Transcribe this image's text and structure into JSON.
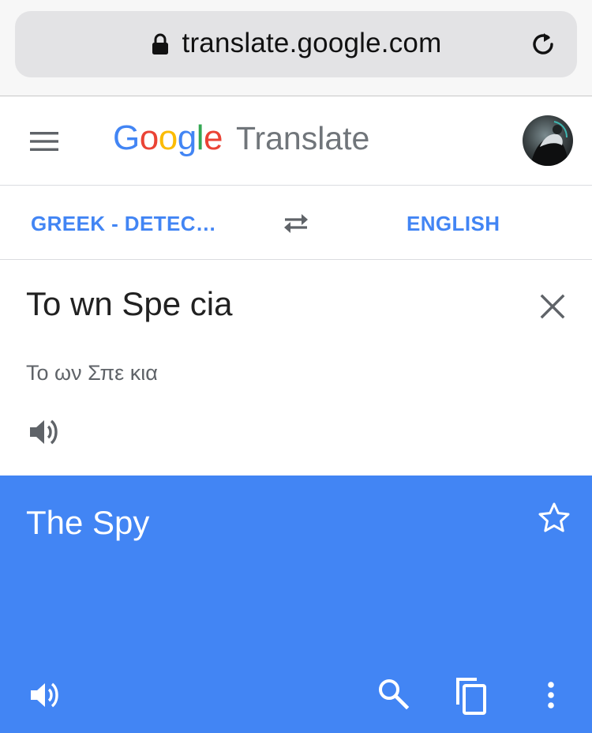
{
  "browser": {
    "url": "translate.google.com",
    "icons": {
      "lock": "lock-icon",
      "reload": "reload-icon"
    }
  },
  "header": {
    "brand_letters": [
      {
        "char": "G",
        "color": "#4285f4"
      },
      {
        "char": "o",
        "color": "#ea4335"
      },
      {
        "char": "o",
        "color": "#fbbc05"
      },
      {
        "char": "g",
        "color": "#4285f4"
      },
      {
        "char": "l",
        "color": "#34a853"
      },
      {
        "char": "e",
        "color": "#ea4335"
      }
    ],
    "product_name": "Translate",
    "icons": {
      "menu": "hamburger-menu-icon",
      "avatar": "account-avatar"
    }
  },
  "language_bar": {
    "source_language": "GREEK - DETEC…",
    "target_language": "ENGLISH",
    "swap_icon": "swap-languages-icon"
  },
  "input": {
    "text": "To wn Spe cia",
    "transliteration": "Το ων Σπε κια",
    "icons": {
      "clear": "close-icon",
      "speak": "speaker-icon"
    }
  },
  "output": {
    "text": "The Spy",
    "background_color": "#4285f4",
    "icons": {
      "star": "star-icon",
      "speak": "speaker-icon",
      "search": "search-icon",
      "copy": "copy-icon",
      "more": "more-vert-icon"
    }
  },
  "colors": {
    "accent": "#4285f4",
    "text_primary": "#212121",
    "text_secondary": "#5f6368",
    "translate_label": "#70757a"
  }
}
